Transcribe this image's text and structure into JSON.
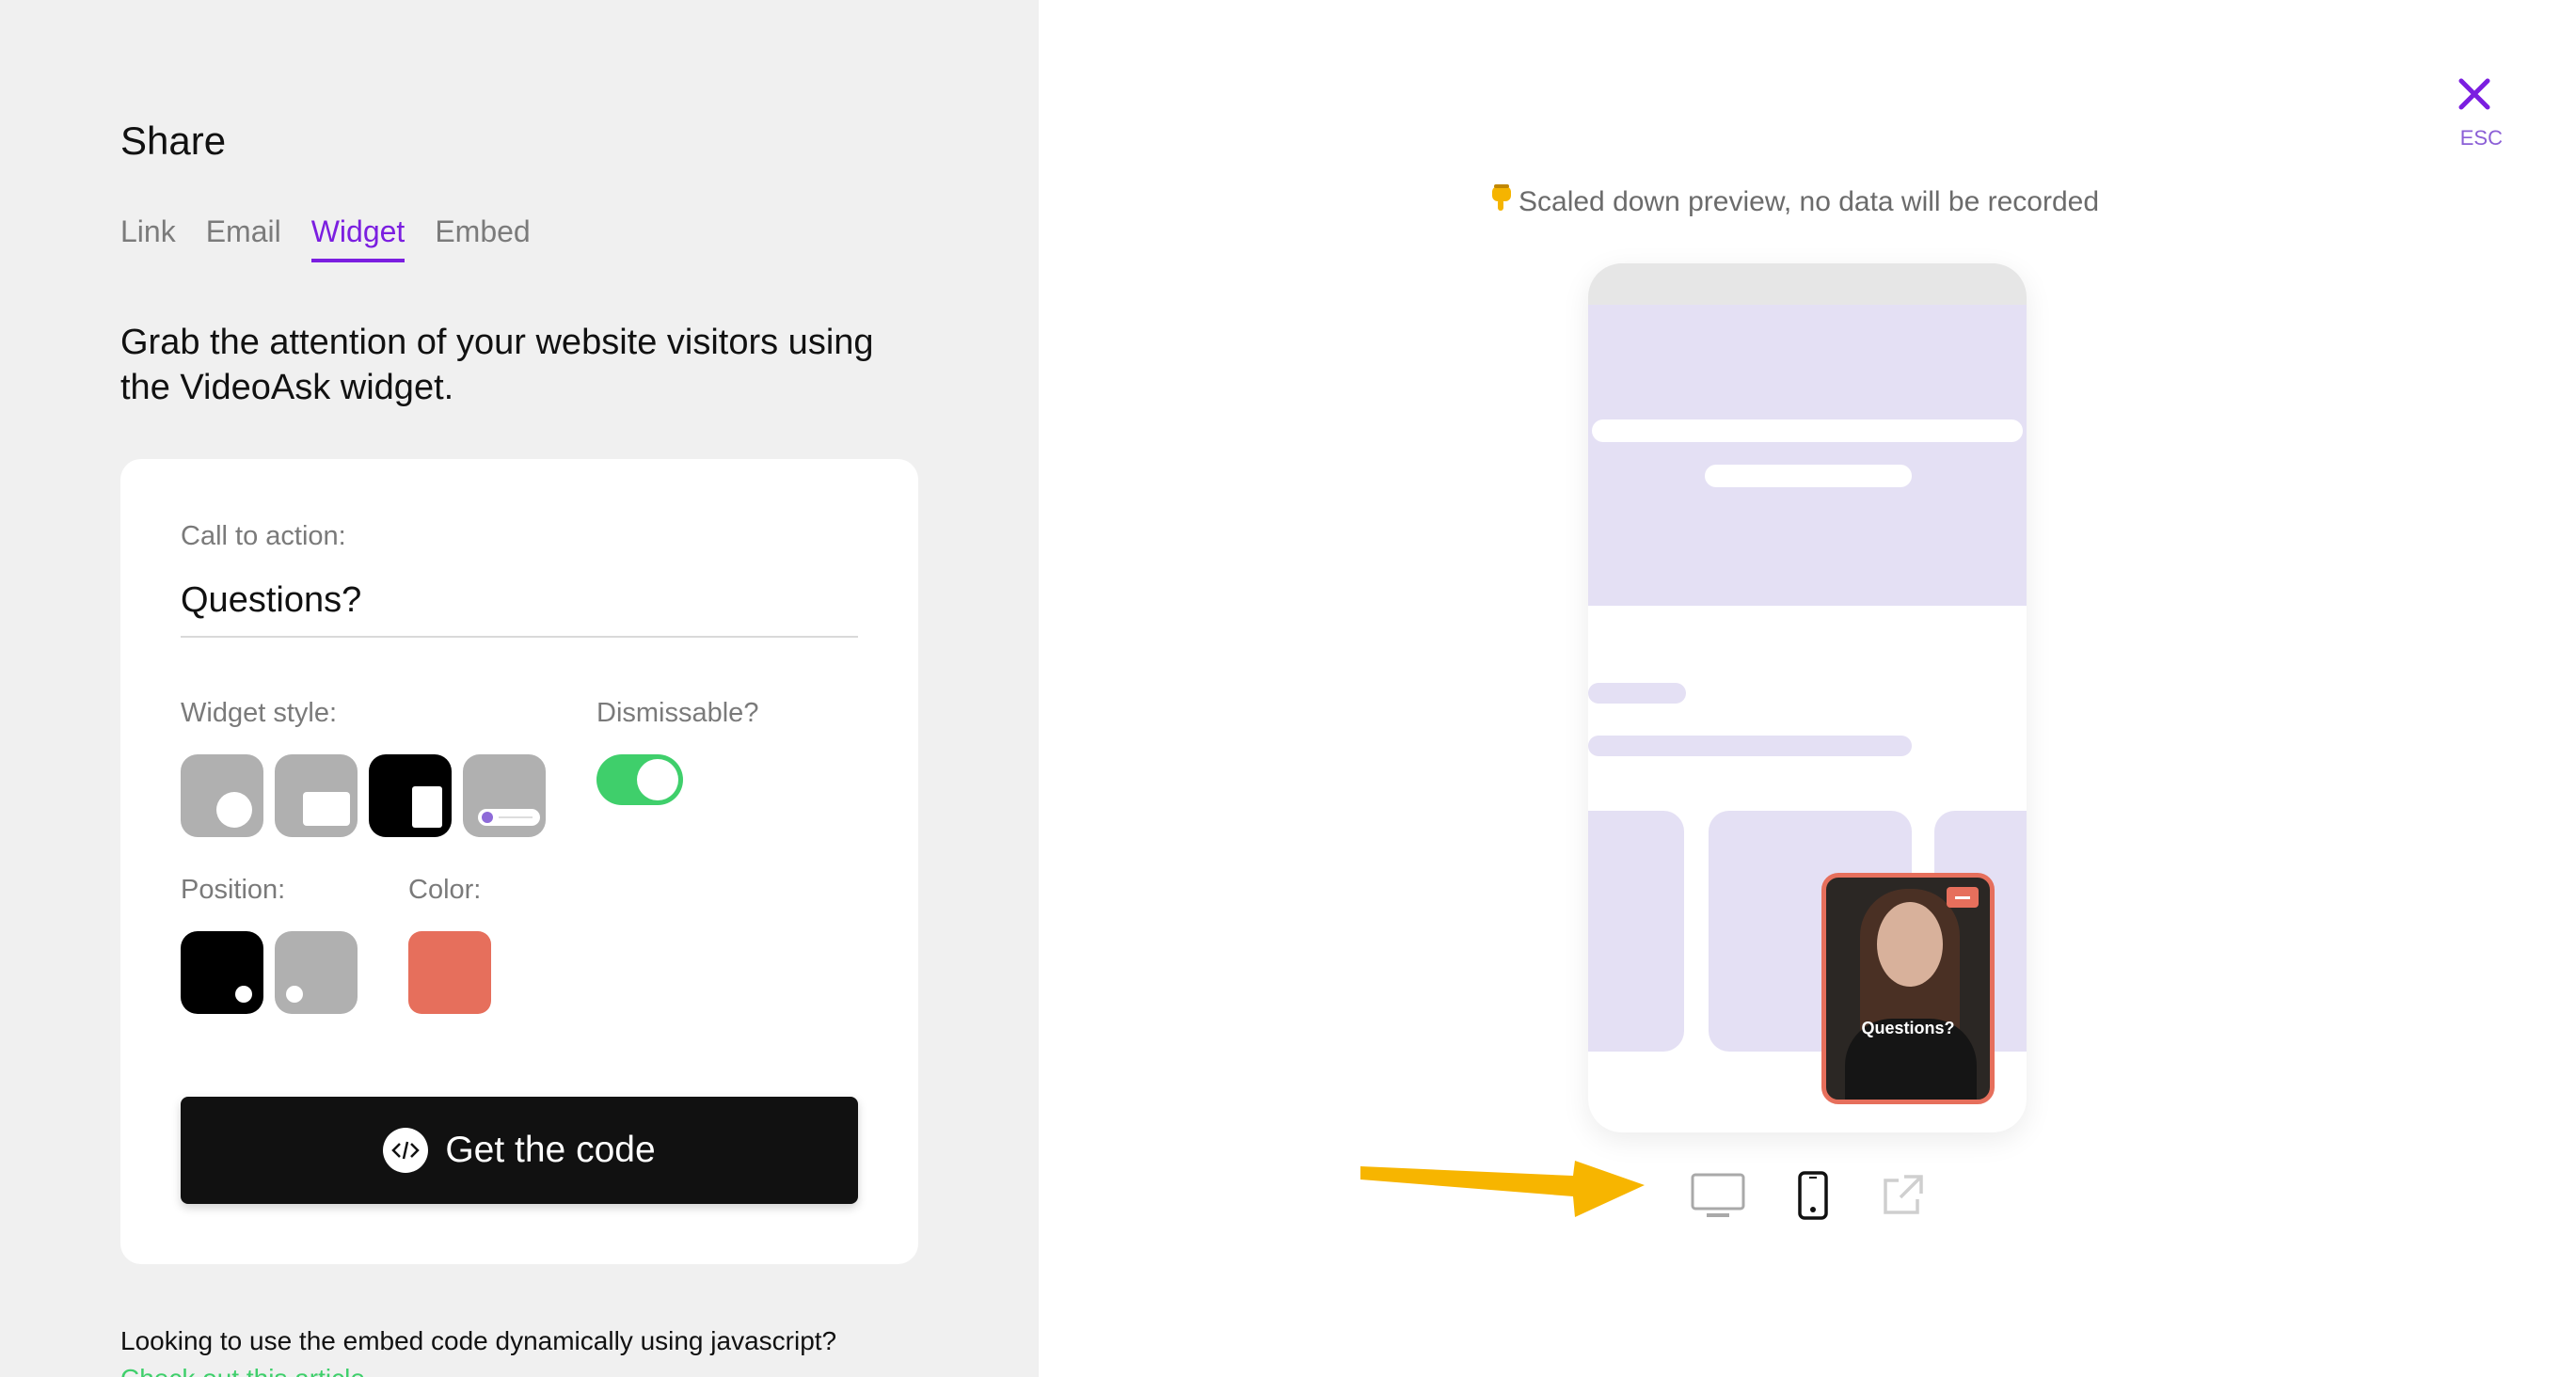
{
  "panel": {
    "title": "Share",
    "tabs": [
      "Link",
      "Email",
      "Widget",
      "Embed"
    ],
    "active_tab": "Widget",
    "headline": "Grab the attention of your website visitors using the VideoAsk widget."
  },
  "form": {
    "cta_label": "Call to action:",
    "cta_value": "Questions?",
    "widget_style_label": "Widget style:",
    "dismissable_label": "Dismissable?",
    "dismissable_on": true,
    "position_label": "Position:",
    "color_label": "Color:",
    "color_value": "#e66f5c",
    "get_code_label": "Get the code"
  },
  "footer": {
    "question": "Looking to use the embed code dynamically using javascript?",
    "link": "Check out this article"
  },
  "preview": {
    "note": "Scaled down preview, no data will be recorded",
    "note_icon": "pointing-down-emoji",
    "widget_caption": "Questions?",
    "esc": "ESC"
  },
  "colors": {
    "accent": "#7b1ee0",
    "toggle": "#3fcf6b",
    "widget": "#e66f5c",
    "arrow": "#f7b500"
  }
}
